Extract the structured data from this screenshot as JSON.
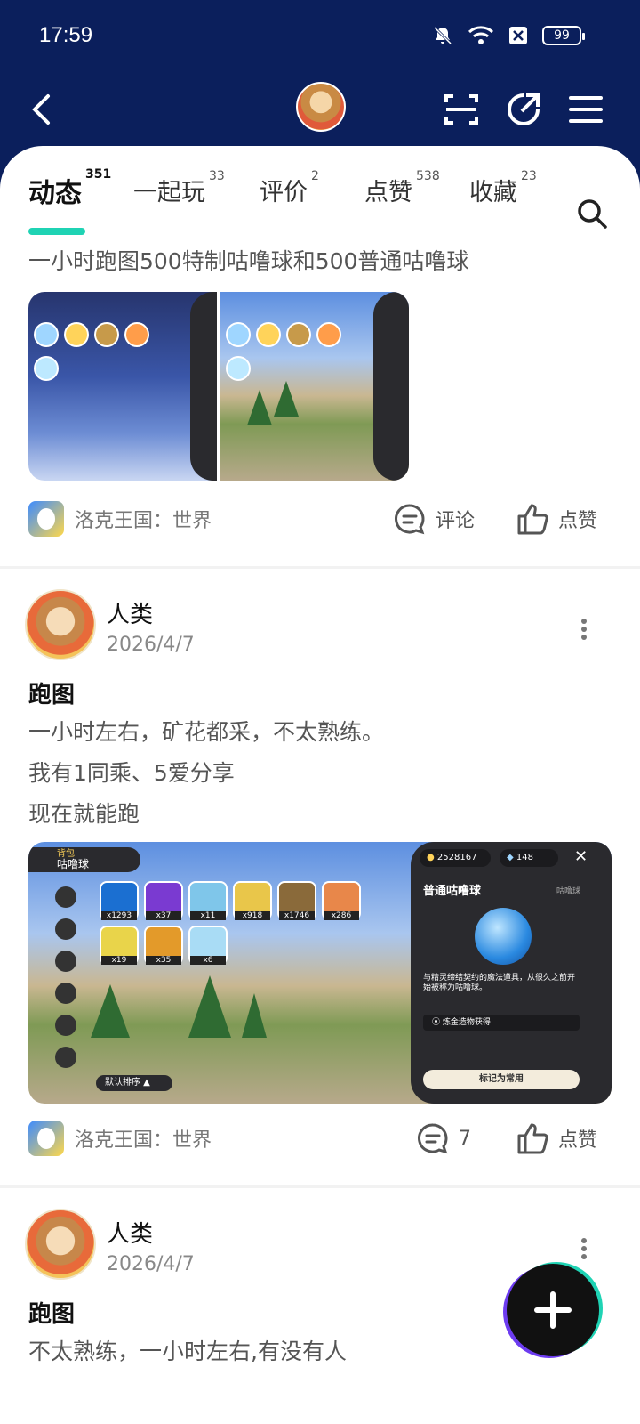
{
  "status_bar": {
    "time": "17:59",
    "battery": "99"
  },
  "tabs": [
    {
      "label": "动态",
      "count": "351"
    },
    {
      "label": "一起玩",
      "count": "33"
    },
    {
      "label": "评价",
      "count": "2"
    },
    {
      "label": "点赞",
      "count": "538"
    },
    {
      "label": "收藏",
      "count": "23"
    }
  ],
  "posts": [
    {
      "text": "一小时跑图500特制咕噜球和500普通咕噜球",
      "game": "洛克王国：世界",
      "comment_label": "评论",
      "like_label": "点赞"
    },
    {
      "user": "人类",
      "date": "2026/4/7",
      "title": "跑图",
      "lines": [
        "一小时左右，矿花都采，不太熟练。",
        "我有1同乘、5爱分享",
        "现在就能跑"
      ],
      "game": "洛克王国：世界",
      "comments": "7",
      "like_label": "点赞",
      "screenshot": {
        "coins": "2528167",
        "gems": "148",
        "bag_label": "背包",
        "bag_title": "咕噜球",
        "item_counts": [
          "x1293",
          "x37",
          "x11",
          "x918",
          "x1746",
          "x286",
          "x19",
          "x35",
          "x6"
        ],
        "panel_title": "普通咕噜球",
        "panel_tag": "咕噜球",
        "panel_desc": "与精灵缔结契约的魔法道具，从很久之前开始被称为咕噜球。",
        "panel_source": "炼金造物获得",
        "panel_button": "标记为常用",
        "sort_label": "默认排序"
      }
    },
    {
      "user": "人类",
      "date": "2026/4/7",
      "title": "跑图",
      "lines": [
        "不太熟练，一小时左右,有没有人"
      ]
    }
  ]
}
